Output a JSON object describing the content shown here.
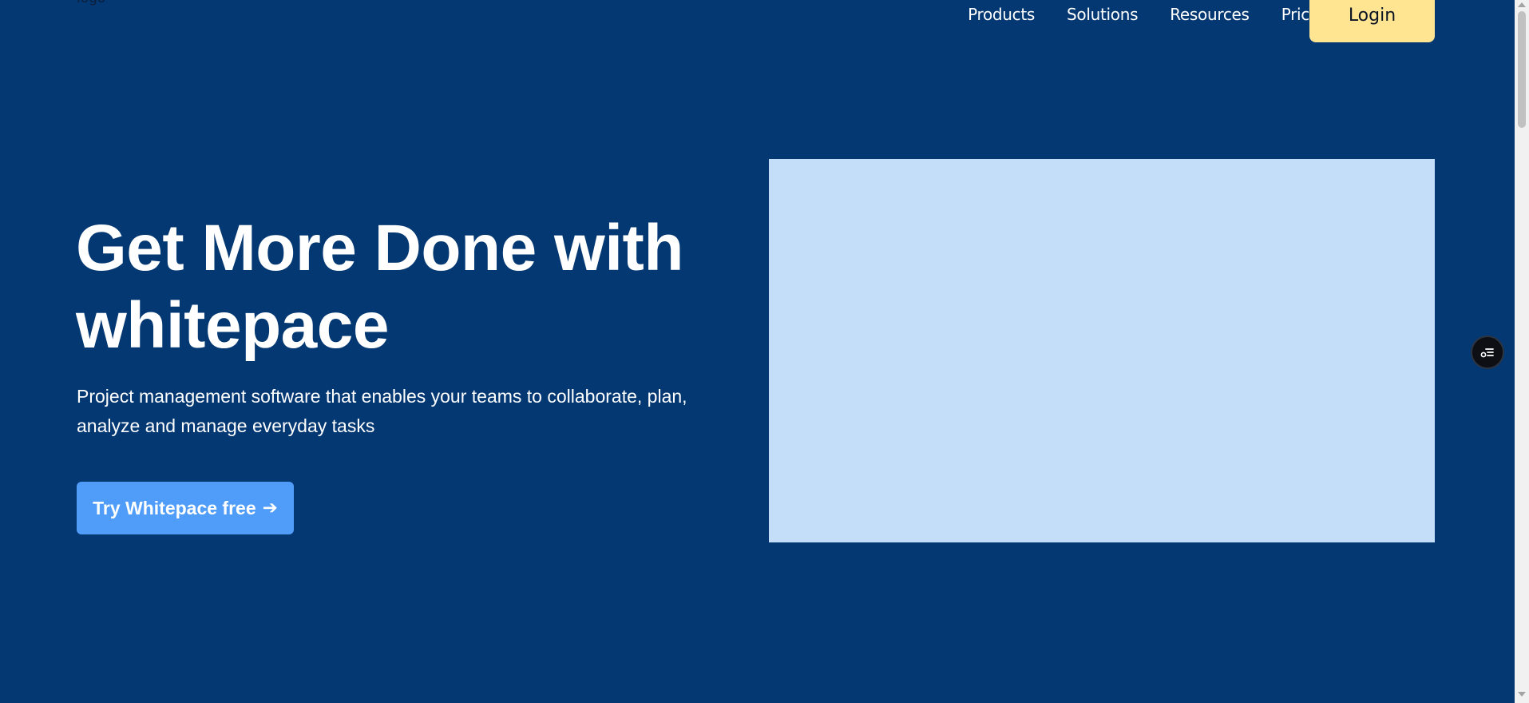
{
  "header": {
    "logo_text": "logo",
    "nav": [
      {
        "label": "Products"
      },
      {
        "label": "Solutions"
      },
      {
        "label": "Resources"
      },
      {
        "label": "Pricing"
      }
    ],
    "login_label": "Login"
  },
  "hero": {
    "title_line1": "Get More Done with",
    "title_line2": "whitepace",
    "subtitle_line1": "Project management software that enables your teams to collaborate, plan,",
    "subtitle_line2": "analyze and manage everyday tasks",
    "cta_label": "Try Whitepace free",
    "cta_arrow": "➔"
  },
  "floating_button": {
    "icon": "filter-settings-icon"
  },
  "colors": {
    "background": "#043873",
    "login_button": "#ffe492",
    "cta_button": "#4f9cf9",
    "hero_image_placeholder": "#c4defa",
    "text": "#ffffff"
  }
}
